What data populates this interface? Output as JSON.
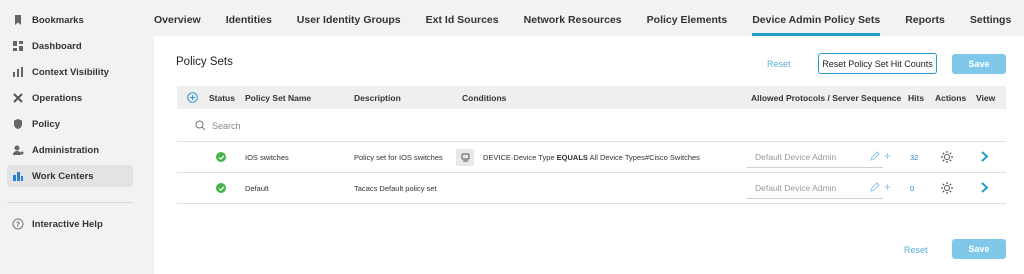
{
  "sidebar": {
    "items": [
      {
        "label": "Bookmarks",
        "icon": "bookmark-icon"
      },
      {
        "label": "Dashboard",
        "icon": "dashboard-icon"
      },
      {
        "label": "Context Visibility",
        "icon": "context-visibility-icon"
      },
      {
        "label": "Operations",
        "icon": "wrench-icon"
      },
      {
        "label": "Policy",
        "icon": "shield-icon"
      },
      {
        "label": "Administration",
        "icon": "admin-icon"
      },
      {
        "label": "Work Centers",
        "icon": "work-centers-icon"
      }
    ],
    "help": {
      "label": "Interactive Help",
      "icon": "help-icon"
    }
  },
  "topnav": {
    "tabs": [
      {
        "label": "Overview"
      },
      {
        "label": "Identities"
      },
      {
        "label": "User Identity Groups"
      },
      {
        "label": "Ext Id Sources"
      },
      {
        "label": "Network Resources"
      },
      {
        "label": "Policy Elements"
      },
      {
        "label": "Device Admin Policy Sets"
      },
      {
        "label": "Reports"
      },
      {
        "label": "Settings"
      }
    ],
    "active": "Device Admin Policy Sets"
  },
  "main": {
    "title": "Policy Sets",
    "reset_label": "Reset",
    "reset_hits_label": "Reset Policy Set Hit Counts",
    "save_label": "Save",
    "columns": {
      "status": "Status",
      "name": "Policy Set Name",
      "description": "Description",
      "conditions": "Conditions",
      "protocols": "Allowed Protocols / Server Sequence",
      "hits": "Hits",
      "actions": "Actions",
      "view": "View"
    },
    "search_placeholder": "Search",
    "rows": [
      {
        "name": "IOS switches",
        "description": "Policy set for IOS switches",
        "condition_attr": "DEVICE·Device Type",
        "condition_op": "EQUALS",
        "condition_val": "All Device Types#Cisco Switches",
        "server": "Default Device Admin",
        "hits": "32"
      },
      {
        "name": "Default",
        "description": "Tacacs Default policy set",
        "condition_attr": "",
        "condition_op": "",
        "condition_val": "",
        "server": "Default Device Admin",
        "hits": "0"
      }
    ],
    "bottom_reset_label": "Reset",
    "bottom_save_label": "Save"
  },
  "colors": {
    "accent": "#1f9fc9",
    "status_ok": "#47b34a",
    "save_button": "#7fc8ea"
  }
}
